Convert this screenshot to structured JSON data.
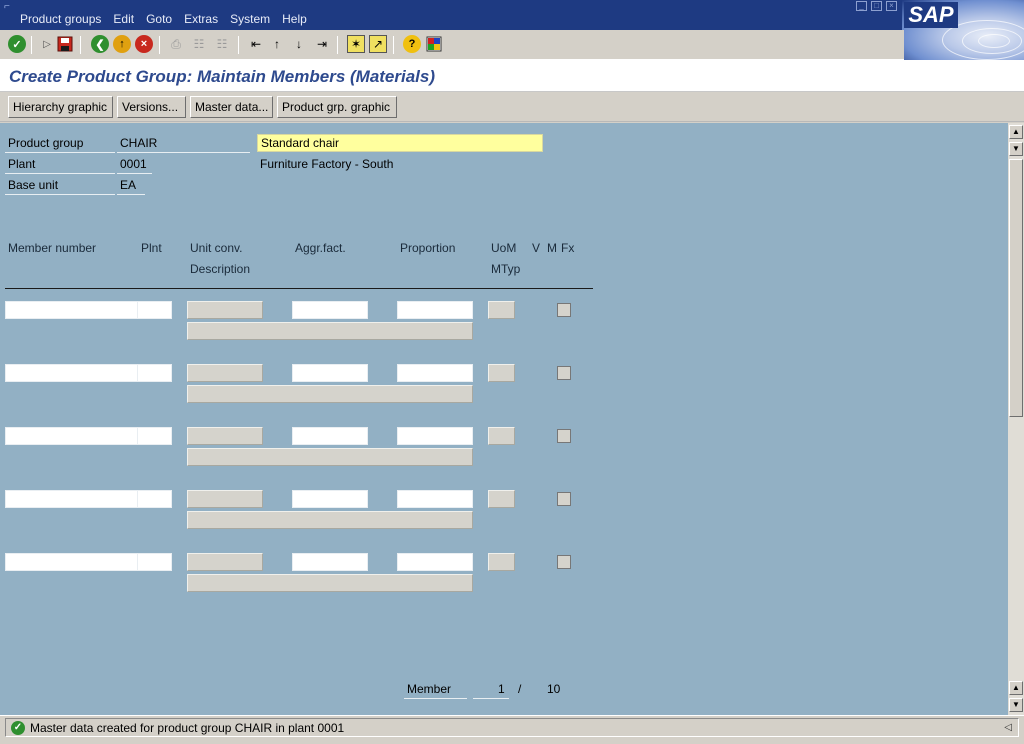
{
  "menu": {
    "items": [
      {
        "label": "Product groups"
      },
      {
        "label": "Edit"
      },
      {
        "label": "Goto"
      },
      {
        "label": "Extras"
      },
      {
        "label": "System"
      },
      {
        "label": "Help"
      }
    ],
    "logo": "SAP"
  },
  "toolbar": {
    "icons": [
      "enter-icon",
      "command-field-icon",
      "save-icon",
      "back-icon",
      "exit-icon",
      "cancel-icon",
      "print-icon",
      "find-icon",
      "find-next-icon",
      "first-page-icon",
      "previous-page-icon",
      "next-page-icon",
      "last-page-icon",
      "create-session-icon",
      "shortcut-icon",
      "help-icon",
      "layout-icon"
    ]
  },
  "title": "Create Product Group: Maintain Members (Materials)",
  "app_toolbar": {
    "buttons": [
      {
        "label": "Hierarchy graphic"
      },
      {
        "label": "Versions..."
      },
      {
        "label": "Master data..."
      },
      {
        "label": "Product grp. graphic"
      }
    ]
  },
  "header": {
    "product_group_label": "Product group",
    "product_group_value": "CHAIR",
    "product_group_desc": "Standard chair",
    "plant_label": "Plant",
    "plant_value": "0001",
    "plant_desc": "Furniture Factory - South",
    "base_unit_label": "Base unit",
    "base_unit_value": "EA"
  },
  "table": {
    "columns": {
      "member_number": "Member number",
      "plnt": "Plnt",
      "unit_conv": "Unit conv.",
      "description": "Description",
      "aggr_fact": "Aggr.fact.",
      "proportion": "Proportion",
      "uom": "UoM",
      "mtyp": "MTyp",
      "v": "V",
      "m": "M",
      "fx": "Fx"
    },
    "rows": [
      {
        "member_number": "",
        "plnt": "",
        "unit_conv": "",
        "aggr_fact": "",
        "proportion": "",
        "uom": "",
        "description": "",
        "fx_checked": false
      },
      {
        "member_number": "",
        "plnt": "",
        "unit_conv": "",
        "aggr_fact": "",
        "proportion": "",
        "uom": "",
        "description": "",
        "fx_checked": false
      },
      {
        "member_number": "",
        "plnt": "",
        "unit_conv": "",
        "aggr_fact": "",
        "proportion": "",
        "uom": "",
        "description": "",
        "fx_checked": false
      },
      {
        "member_number": "",
        "plnt": "",
        "unit_conv": "",
        "aggr_fact": "",
        "proportion": "",
        "uom": "",
        "description": "",
        "fx_checked": false
      },
      {
        "member_number": "",
        "plnt": "",
        "unit_conv": "",
        "aggr_fact": "",
        "proportion": "",
        "uom": "",
        "description": "",
        "fx_checked": false
      }
    ]
  },
  "pager": {
    "label": "Member",
    "current": "1",
    "separator": "/",
    "total": "10"
  },
  "status": {
    "message": "Master data created for product group CHAIR in plant 0001",
    "type": "success"
  },
  "colors": {
    "menubar": "#1e3a82",
    "title_text": "#2e4a8e",
    "workarea": "#92b0c4",
    "highlight_field": "#ffff9e",
    "success": "#2f8f2f"
  }
}
